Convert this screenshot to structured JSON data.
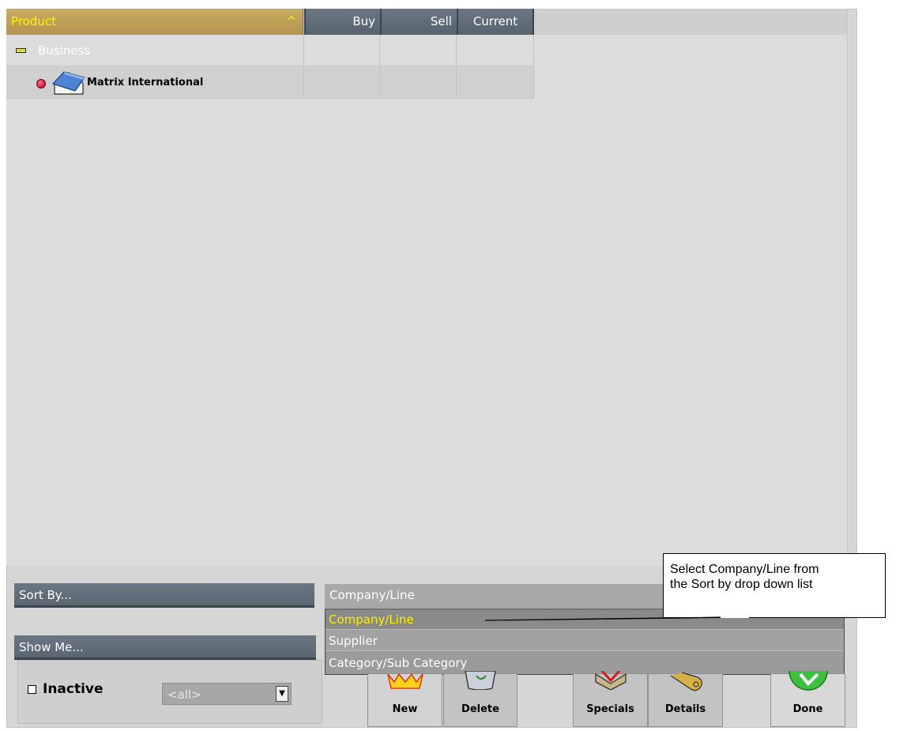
{
  "grid": {
    "columns": {
      "product": "Product",
      "buy": "Buy",
      "sell": "Sell",
      "current": "Current"
    },
    "rows": [
      {
        "label": "Business"
      },
      {
        "label": "Matrix International"
      }
    ]
  },
  "sort": {
    "label": "Sort By...",
    "selected": "Company/Line",
    "options": [
      "Company/Line",
      "Supplier",
      "Category/Sub Category"
    ]
  },
  "show": {
    "label": "Show Me...",
    "inactive_label": "Inactive",
    "filter_value": "<all>"
  },
  "buttons": {
    "new": "New",
    "delete": "Delete",
    "specials": "Specials",
    "details": "Details",
    "done": "Done"
  },
  "callout": {
    "line1": "Select Company/Line from",
    "line2": "the Sort by drop down list"
  },
  "colors": {
    "accent_yellow": "#fff200",
    "header_dark": "#5f6b76",
    "header_product": "#c0a35a"
  }
}
